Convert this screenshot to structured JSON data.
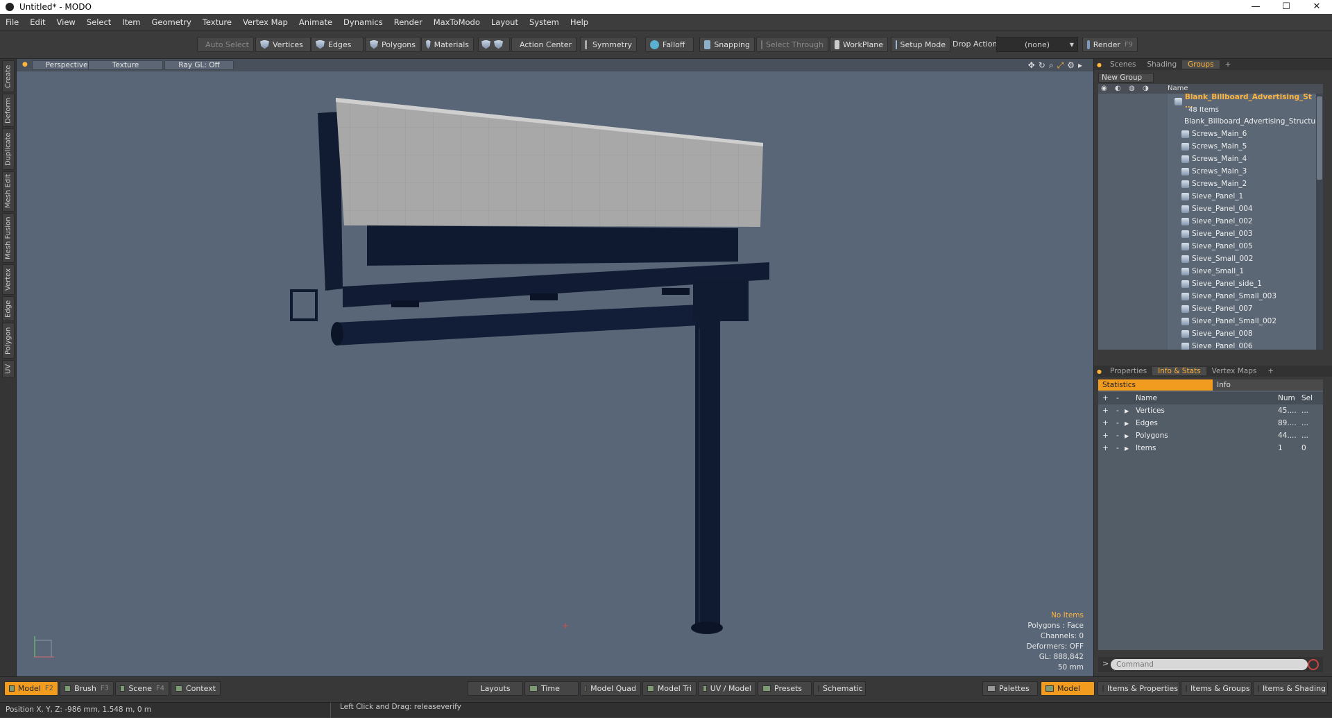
{
  "window": {
    "title": "Untitled* - MODO",
    "minimize": "—",
    "maximize": "☐",
    "close": "✕"
  },
  "menu": [
    "File",
    "Edit",
    "View",
    "Select",
    "Item",
    "Geometry",
    "Texture",
    "Vertex Map",
    "Animate",
    "Dynamics",
    "Render",
    "MaxToModo",
    "Layout",
    "System",
    "Help"
  ],
  "toolbar": {
    "auto_select": "Auto Select",
    "vertices": "Vertices",
    "edges": "Edges",
    "polygons": "Polygons",
    "materials": "Materials",
    "action_center": "Action Center",
    "symmetry": "Symmetry",
    "falloff": "Falloff",
    "snapping": "Snapping",
    "select_through": "Select Through",
    "workplane": "WorkPlane",
    "setup_mode": "Setup Mode",
    "drop_action": "Drop Action",
    "drop_value": "(none)",
    "render": "Render",
    "render_key": "F9"
  },
  "left_tabs": [
    "Create",
    "Deform",
    "Duplicate",
    "Mesh Edit",
    "Mesh Fusion",
    "Vertex",
    "Edge",
    "Polygon",
    "UV"
  ],
  "viewport": {
    "view": "Perspective",
    "shading": "Texture",
    "raygl": "Ray GL: Off",
    "info": {
      "no_items": "No Items",
      "polygons": "Polygons : Face",
      "channels": "Channels: 0",
      "deformers": "Deformers: OFF",
      "gl": "GL: 888,842",
      "scale": "50 mm"
    }
  },
  "groups_panel": {
    "tabs": [
      "Scenes",
      "Shading",
      "Groups"
    ],
    "active_tab": "Groups",
    "new_group": "New Group",
    "name_header": "Name",
    "group_name": "Blank_Billboard_Advertising_St ...",
    "group_count": "48 Items",
    "items": [
      "Blank_Billboard_Advertising_Structure",
      "Screws_Main_6",
      "Screws_Main_5",
      "Screws_Main_4",
      "Screws_Main_3",
      "Screws_Main_2",
      "Sieve_Panel_1",
      "Sieve_Panel_004",
      "Sieve_Panel_002",
      "Sieve_Panel_003",
      "Sieve_Panel_005",
      "Sieve_Small_002",
      "Sieve_Small_1",
      "Sieve_Panel_side_1",
      "Sieve_Panel_Small_003",
      "Sieve_Panel_007",
      "Sieve_Panel_Small_002",
      "Sieve_Panel_008",
      "Sieve_Panel_006"
    ]
  },
  "stats_panel": {
    "tabs": [
      "Properties",
      "Info & Stats",
      "Vertex Maps"
    ],
    "active_tab": "Info & Stats",
    "sub_statistics": "Statistics",
    "sub_info": "Info",
    "headers": {
      "name": "Name",
      "num": "Num",
      "sel": "Sel"
    },
    "rows": [
      {
        "name": "Vertices",
        "num": "45....",
        "sel": "..."
      },
      {
        "name": "Edges",
        "num": "89....",
        "sel": "..."
      },
      {
        "name": "Polygons",
        "num": "44....",
        "sel": "..."
      },
      {
        "name": "Items",
        "num": "1",
        "sel": "0"
      }
    ],
    "command_placeholder": "Command"
  },
  "bottombar": {
    "model": "Model",
    "model_key": "F2",
    "brush": "Brush",
    "brush_key": "F3",
    "scene": "Scene",
    "scene_key": "F4",
    "context": "Context",
    "layouts": "Layouts",
    "time": "Time",
    "model_quad": "Model Quad",
    "model_tri": "Model Tri",
    "uv_model": "UV / Model",
    "presets": "Presets",
    "schematic": "Schematic",
    "palettes": "Palettes",
    "model2": "Model",
    "items_properties": "Items & Properties",
    "items_groups": "Items & Groups",
    "items_shading": "Items & Shading"
  },
  "status": {
    "position": "Position X, Y, Z:   -986 mm, 1.548 m, 0 m",
    "hint": "Left Click and Drag:  releaseverify"
  }
}
